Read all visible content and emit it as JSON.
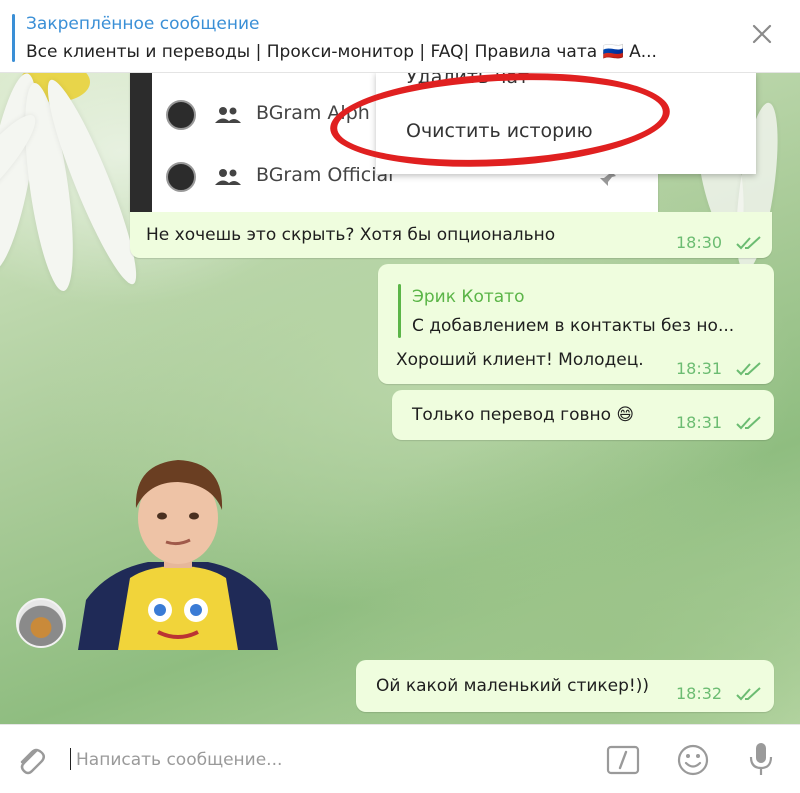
{
  "pinned": {
    "title": "Закреплённое сообщение",
    "text": "Все клиенты и переводы | Прокси-монитор | FAQ| Правила чата 🇷🇺 А..."
  },
  "screenshot": {
    "rows": [
      {
        "name": "BGram Alph"
      },
      {
        "name": "BGram Official"
      }
    ],
    "menu": {
      "item1": "Удалить чат",
      "item2": "Очистить историю"
    }
  },
  "messages": [
    {
      "text": "Не хочешь это скрыть? Хотя бы опционально",
      "time": "18:30"
    },
    {
      "reply_name": "Эрик Котато",
      "reply_text": "С добавлением в контакты без но...",
      "text": "Хороший клиент! Молодец.",
      "time": "18:31"
    },
    {
      "text": "Только перевод говно 😄",
      "time": "18:31"
    },
    {
      "text": "Ой какой маленький стикер!))",
      "time": "18:32"
    }
  ],
  "composer": {
    "placeholder": "Написать сообщение..."
  },
  "colors": {
    "accent": "#3a8fd6",
    "bubble": "#effdde",
    "time": "#6cbc72",
    "highlight": "#e02020"
  }
}
